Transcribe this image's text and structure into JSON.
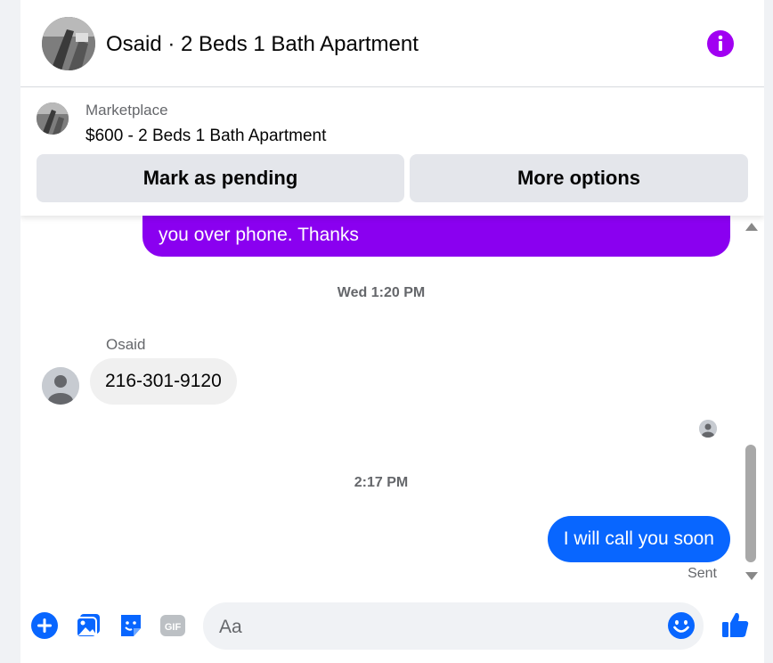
{
  "header": {
    "title": "Osaid · 2 Beds 1 Bath Apartment",
    "info_icon": "info-icon"
  },
  "marketplace": {
    "label": "Marketplace",
    "item": "$600 - 2 Beds 1 Bath Apartment",
    "mark_pending_label": "Mark as pending",
    "more_options_label": "More options"
  },
  "messages": {
    "partial_outgoing_text": "you over phone. Thanks",
    "timestamp_1": "Wed 1:20 PM",
    "sender_name": "Osaid",
    "incoming_text": "216-301-9120",
    "timestamp_2": "2:17 PM",
    "outgoing_text": "I will call you soon",
    "status": "Sent"
  },
  "composer": {
    "placeholder": "Aa",
    "icons": [
      "plus-icon",
      "image-icon",
      "sticker-icon",
      "gif-icon",
      "emoji-icon",
      "thumbs-up-icon"
    ],
    "gif_label": "GIF"
  },
  "colors": {
    "accent_purple": "#8a00f0",
    "accent_blue": "#0866ff",
    "info_purple": "#a100f2"
  }
}
